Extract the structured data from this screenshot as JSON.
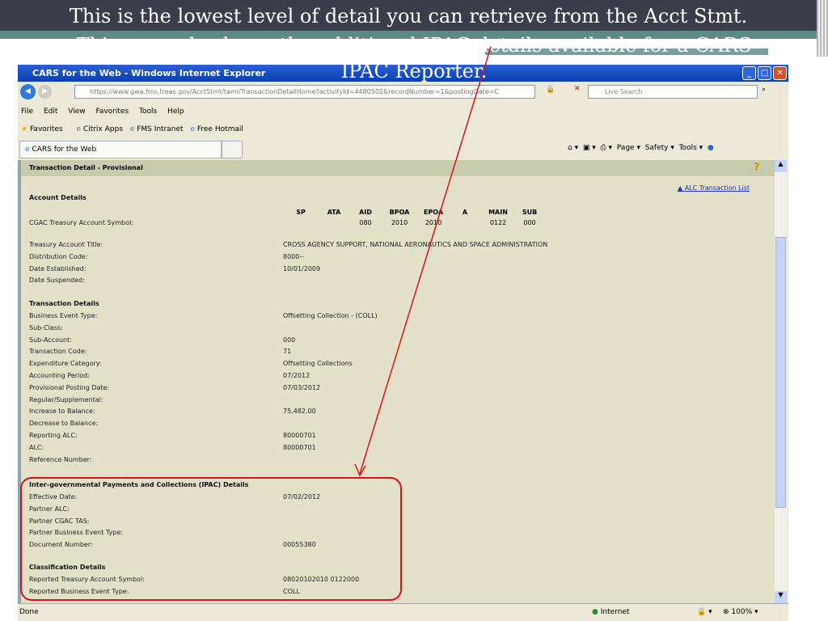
{
  "slide": {
    "title_line1": "This is the lowest level of detail you can retrieve from the Acct Stmt.",
    "title_line2": "This example shows the additional IPAC details available for a CARS IPAC Reporter."
  },
  "browser": {
    "window_title": "CARS for the Web - Windows Internet Explorer",
    "url": "https://www.gwa.fms.treas.gov/AcctStmt/tami/TransactionDetailHome?activityId=4480502&recordNumber=1&postingDate=C",
    "search_placeholder": "Live Search",
    "menu": [
      "File",
      "Edit",
      "View",
      "Favorites",
      "Tools",
      "Help"
    ],
    "favorites_label": "Favorites",
    "favorites": [
      "Citrix Apps",
      "FMS Intranet",
      "Free Hotmail"
    ],
    "tab": "CARS for the Web",
    "toolbar": [
      "Page",
      "Safety",
      "Tools"
    ],
    "status": "Done",
    "zone": "Internet",
    "zoom": "100%"
  },
  "page": {
    "header": "Transaction Detail - Provisional",
    "alc_link": "ALC Transaction List",
    "account_details": "Account Details",
    "tas_columns": [
      "SP",
      "ATA",
      "AID",
      "BPOA",
      "EPOA",
      "A",
      "MAIN",
      "SUB"
    ],
    "tas_values": [
      "",
      "",
      "080",
      "2010",
      "2010",
      "",
      "0122",
      "000"
    ],
    "cgac_label": "CGAC Treasury Account Symbol:",
    "account_rows": [
      [
        "Treasury Account Title:",
        "CROSS AGENCY SUPPORT, NATIONAL AERONAUTICS AND SPACE ADMINISTRATION"
      ],
      [
        "Distribution Code:",
        "8000--"
      ],
      [
        "Date Established:",
        "10/01/2009"
      ],
      [
        "Date Suspended:",
        ""
      ]
    ],
    "transaction_details": "Transaction Details",
    "transaction_rows": [
      [
        "Business Event Type:",
        "Offsetting Collection - (COLL)"
      ],
      [
        "Sub-Class:",
        ""
      ],
      [
        "Sub-Account:",
        "000"
      ],
      [
        "Transaction Code:",
        "71"
      ],
      [
        "Expenditure Category:",
        "Offsetting Collections"
      ],
      [
        "Accounting Period:",
        "07/2012"
      ],
      [
        "Provisional Posting Date:",
        "07/03/2012"
      ],
      [
        "Regular/Supplemental:",
        ""
      ],
      [
        "Increase to Balance:",
        "75,482.00"
      ],
      [
        "Decrease to Balance:",
        ""
      ],
      [
        "Reporting ALC:",
        "80000701"
      ],
      [
        "ALC:",
        "80000701"
      ],
      [
        "Reference Number:",
        ""
      ]
    ],
    "ipac_details": "Inter-governmental Payments and Collections (IPAC) Details",
    "ipac_rows": [
      [
        "Effective Date:",
        "07/02/2012"
      ],
      [
        "Partner ALC:",
        ""
      ],
      [
        "Partner CGAC TAS:",
        ""
      ],
      [
        "Partner Business Event Type:",
        ""
      ],
      [
        "Document Number:",
        "00055380"
      ]
    ],
    "classification_details": "Classification Details",
    "classification_rows": [
      [
        "Reported Treasury Account Symbol:",
        "08020102010 0122000"
      ],
      [
        "Reported Business Event Type:",
        "COLL"
      ]
    ]
  },
  "colors": {
    "annotation": "#e0101a",
    "content_bg": "#e3e2c8",
    "title_bar": "#0a3fb0"
  }
}
